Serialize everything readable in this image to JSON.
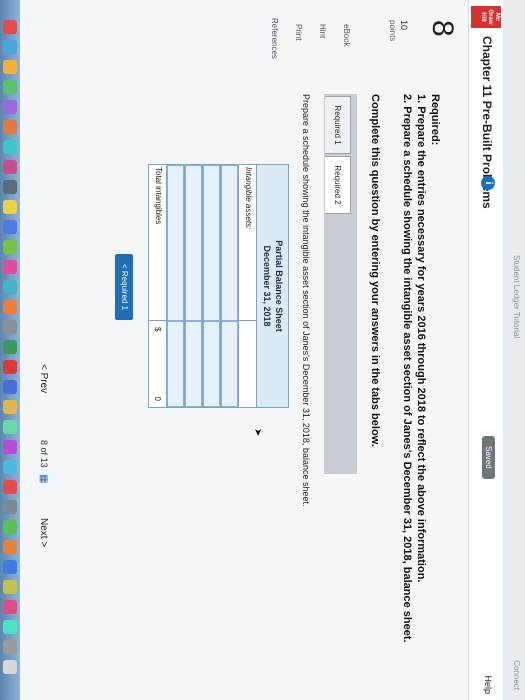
{
  "header": {
    "status_text": "Student Ledger Tutorial",
    "connect_label": "Connect",
    "logo_text": "Mc Graw Hill",
    "chapter_title": "Chapter 11 Pre-Built Problems",
    "info_icon": "i",
    "saved_label": "Saved",
    "help_label": "Help"
  },
  "sidebar": {
    "question_number": "8",
    "points_value": "10",
    "points_label": "points",
    "links": [
      "eBook",
      "Hint",
      "Print",
      "References"
    ]
  },
  "problem": {
    "required_heading": "Required:",
    "required_items": [
      "1. Prepare the entries necessary for years 2016 through 2018 to reflect the above information.",
      "2. Prepare a schedule showing the intangible asset section of Janes's December 31, 2018, balance sheet."
    ],
    "instruction": "Complete this question by entering your answers in the tabs below.",
    "tabs": [
      "Required 1",
      "Required 2"
    ],
    "schedule_prompt": "Prepare a schedule showing the intangible asset section of Janes's December 31, 2018, balance sheet."
  },
  "sheet": {
    "title": "Partial Balance Sheet",
    "date": "December 31, 2018",
    "section_label": "Intangible assets:",
    "total_label": "Total intangibles",
    "currency": "$",
    "total_value": "0"
  },
  "nav": {
    "back_tab_button": "< Required 1",
    "prev_label": "< Prev",
    "current_page": "8",
    "of_label": "of",
    "total_pages": "13",
    "grid_icon": "grid-icon",
    "next_label": "Next >"
  },
  "colors": {
    "accent": "#1e6fb8",
    "sheet_header_bg": "#dceaf5",
    "input_bg": "#e4f0fa",
    "logo_red": "#d8322f"
  }
}
